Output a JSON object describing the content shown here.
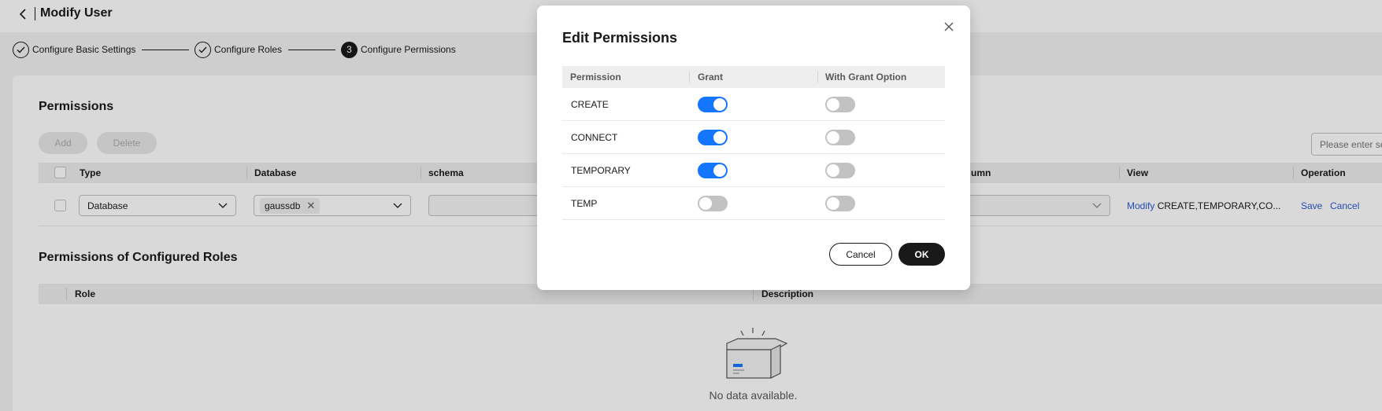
{
  "header": {
    "title": "Modify User"
  },
  "steps": [
    {
      "label": "Configure Basic Settings",
      "state": "done"
    },
    {
      "label": "Configure Roles",
      "state": "done"
    },
    {
      "label": "Configure Permissions",
      "state": "current",
      "number": "3"
    }
  ],
  "permissions_section": {
    "title": "Permissions",
    "add_label": "Add",
    "delete_label": "Delete",
    "search_placeholder": "Please enter se",
    "columns": [
      "Type",
      "Database",
      "schema",
      "umn",
      "View",
      "Operation"
    ],
    "row": {
      "type": "Database",
      "database_tag": "gaussdb",
      "view_link": "Modify",
      "view_value": "CREATE,TEMPORARY,CO...",
      "save_label": "Save",
      "cancel_label": "Cancel"
    }
  },
  "roles_section": {
    "title": "Permissions of Configured Roles",
    "columns": [
      "Role",
      "Description"
    ],
    "empty_text": "No data available."
  },
  "modal": {
    "title": "Edit Permissions",
    "columns": [
      "Permission",
      "Grant",
      "With Grant Option"
    ],
    "rows": [
      {
        "name": "CREATE",
        "grant": true,
        "with_grant_option": false
      },
      {
        "name": "CONNECT",
        "grant": true,
        "with_grant_option": false
      },
      {
        "name": "TEMPORARY",
        "grant": true,
        "with_grant_option": false
      },
      {
        "name": "TEMP",
        "grant": false,
        "with_grant_option": false
      }
    ],
    "cancel_label": "Cancel",
    "ok_label": "OK"
  },
  "colors": {
    "accent": "#1476ff",
    "link": "#2d5ad3",
    "primary_button": "#191919"
  }
}
